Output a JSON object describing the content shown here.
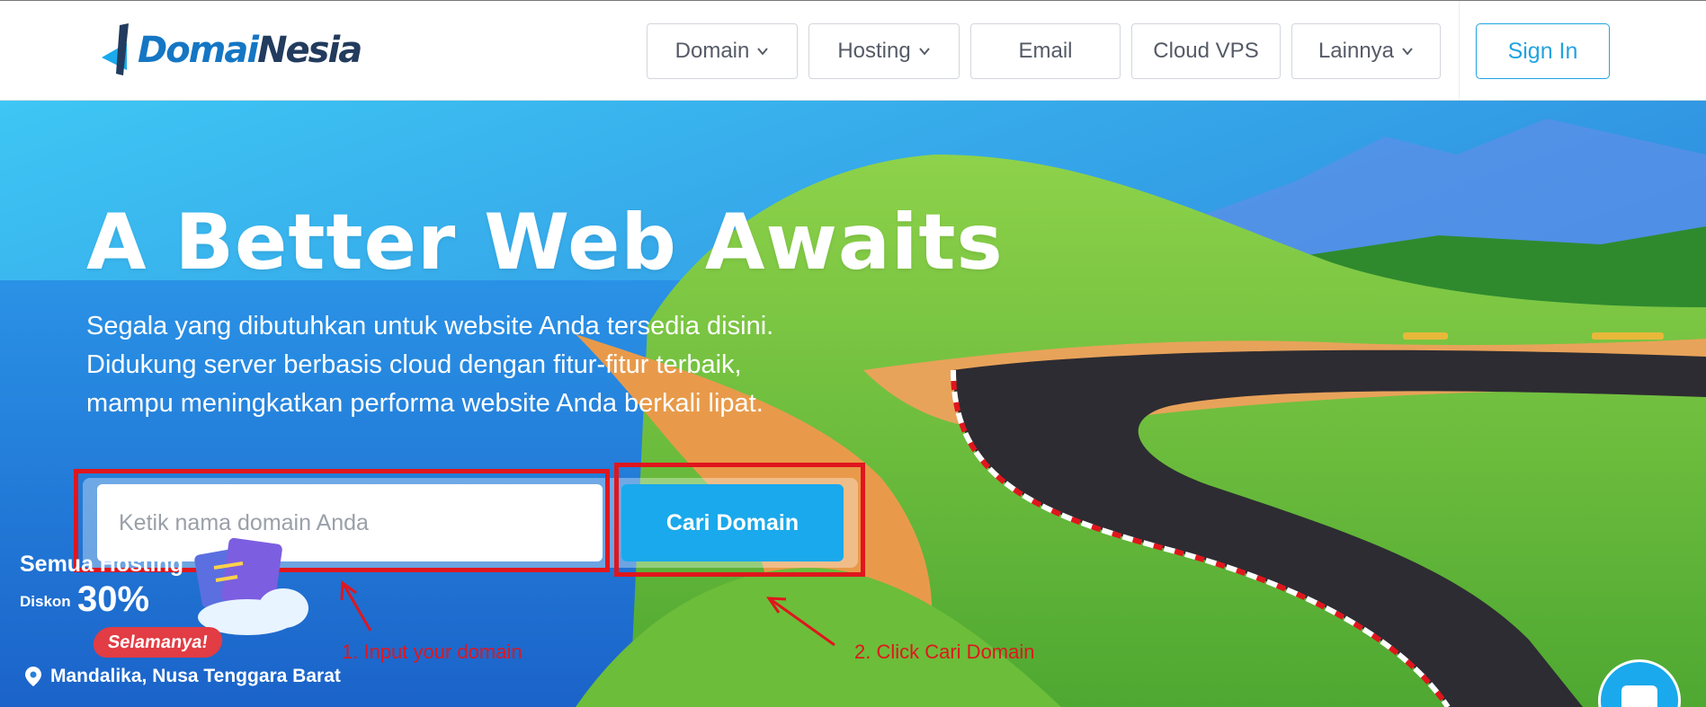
{
  "header": {
    "logo": {
      "text_part1": "Domai",
      "text_part2": "Nesia"
    },
    "nav": [
      {
        "label": "Domain",
        "has_dropdown": true
      },
      {
        "label": "Hosting",
        "has_dropdown": true
      },
      {
        "label": "Email",
        "has_dropdown": false
      },
      {
        "label": "Cloud VPS",
        "has_dropdown": false
      },
      {
        "label": "Lainnya",
        "has_dropdown": true
      }
    ],
    "signin_label": "Sign In"
  },
  "hero": {
    "title": "A Better Web Awaits",
    "subtitle_lines": [
      "Segala yang dibutuhkan untuk website Anda tersedia disini.",
      "Didukung server berbasis cloud dengan fitur-fitur terbaik,",
      "mampu meningkatkan performa website Anda berkali lipat."
    ],
    "search": {
      "placeholder": "Ketik nama domain Anda",
      "value": "",
      "button_label": "Cari Domain"
    },
    "promo": {
      "headline": "Semua Hosting",
      "diskon_label": "Diskon",
      "percent": "30%",
      "badge": "Selamanya!"
    },
    "location": "Mandalika, Nusa Tenggara Barat"
  },
  "annotations": {
    "step1": "1. Input your domain",
    "step2": "2. Click Cari Domain"
  },
  "colors": {
    "accent": "#1aa9ec",
    "signin": "#21a3e0",
    "annotation_red": "#e0161d",
    "logo_blue": "#1576c4",
    "logo_dark": "#223b5e"
  },
  "icons": {
    "dropdown": "chevron-down-icon",
    "location": "map-pin-icon",
    "chat": "chat-icon"
  }
}
